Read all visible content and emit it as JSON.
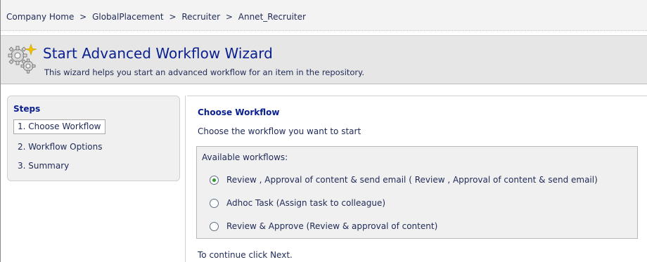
{
  "breadcrumb": {
    "items": [
      "Company Home",
      "GlobalPlacement",
      "Recruiter",
      "Annet_Recruiter"
    ],
    "separator": ">"
  },
  "header": {
    "title": "Start Advanced Workflow Wizard",
    "description": "This wizard helps you start an advanced workflow for an item in the repository.",
    "icon": "workflow-gears-icon"
  },
  "steps": {
    "title": "Steps",
    "items": [
      {
        "label": "1. Choose Workflow",
        "active": true
      },
      {
        "label": "2. Workflow Options",
        "active": false
      },
      {
        "label": "3. Summary",
        "active": false
      }
    ]
  },
  "main": {
    "title": "Choose Workflow",
    "description": "Choose the workflow you want to start",
    "workflows_label": "Available workflows:",
    "options": [
      {
        "label": "Review , Approval of content & send email ( Review , Approval of content & send email)",
        "selected": true
      },
      {
        "label": "Adhoc Task (Assign task to colleague)",
        "selected": false
      },
      {
        "label": "Review & Approve (Review & approval of content)",
        "selected": false
      }
    ],
    "continue_text": "To continue click Next."
  },
  "colors": {
    "title_blue": "#0a1f8f",
    "text_navy": "#1f2a57",
    "radio_selected": "#2b9a2b"
  }
}
